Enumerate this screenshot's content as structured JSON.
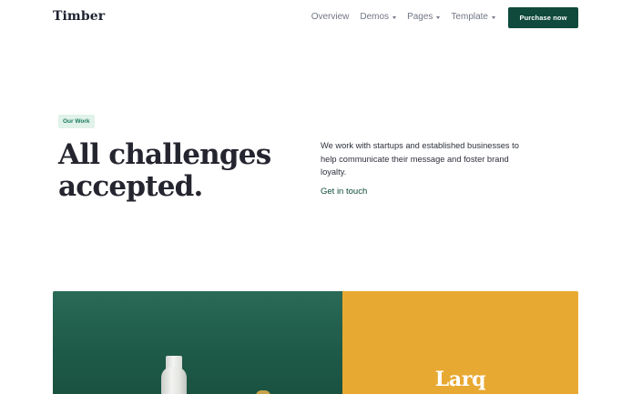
{
  "header": {
    "brand": "Timber",
    "nav": [
      {
        "label": "Overview",
        "has_dropdown": false
      },
      {
        "label": "Demos",
        "has_dropdown": true
      },
      {
        "label": "Pages",
        "has_dropdown": true
      },
      {
        "label": "Template",
        "has_dropdown": true
      }
    ],
    "cta_label": "Purchase now"
  },
  "hero": {
    "badge": "Our Work",
    "headline_line1": "All challenges",
    "headline_line2": "accepted.",
    "lead": "We work with startups and established businesses to help communicate their message and foster brand loyalty.",
    "link_label": "Get in touch"
  },
  "showcase": {
    "project_title": "Larq"
  },
  "colors": {
    "primary": "#0f4a3c",
    "badge_bg": "#e0f2ea",
    "showcase_green": "#1e5a48",
    "showcase_yellow": "#e8a932"
  }
}
